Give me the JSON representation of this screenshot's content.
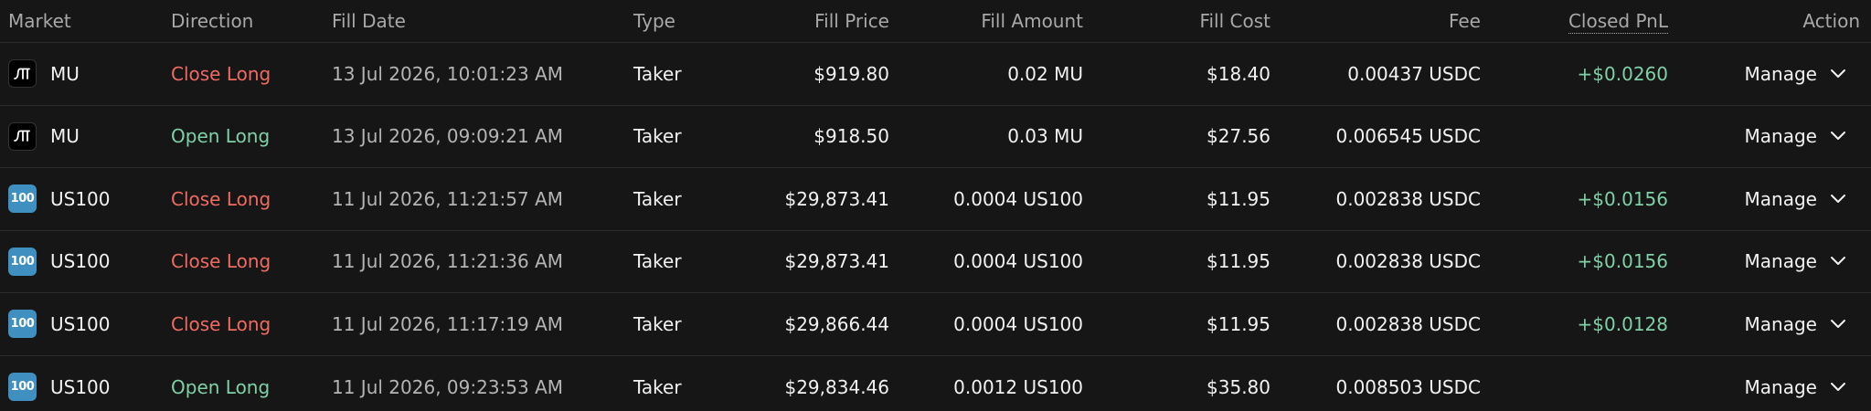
{
  "headers": {
    "market": "Market",
    "direction": "Direction",
    "fill_date": "Fill Date",
    "type": "Type",
    "fill_price": "Fill Price",
    "fill_amount": "Fill Amount",
    "fill_cost": "Fill Cost",
    "fee": "Fee",
    "closed_pnl": "Closed PnL",
    "action": "Action"
  },
  "colors": {
    "close": "#ef6b62",
    "open": "#7fd0a6",
    "us100_icon": "#3f8fc0"
  },
  "rows": [
    {
      "market": "MU",
      "icon": "mu-logo-icon",
      "icon_text": "",
      "direction": "Close Long",
      "direction_kind": "close",
      "fill_date": "13 Jul 2026, 10:01:23 AM",
      "type": "Taker",
      "fill_price": "$919.80",
      "fill_amount": "0.02 MU",
      "fill_cost": "$18.40",
      "fee": "0.00437 USDC",
      "closed_pnl": "+$0.0260",
      "action": "Manage"
    },
    {
      "market": "MU",
      "icon": "mu-logo-icon",
      "icon_text": "",
      "direction": "Open Long",
      "direction_kind": "open",
      "fill_date": "13 Jul 2026, 09:09:21 AM",
      "type": "Taker",
      "fill_price": "$918.50",
      "fill_amount": "0.03 MU",
      "fill_cost": "$27.56",
      "fee": "0.006545 USDC",
      "closed_pnl": "",
      "action": "Manage"
    },
    {
      "market": "US100",
      "icon": "us100-logo-icon",
      "icon_text": "100",
      "direction": "Close Long",
      "direction_kind": "close",
      "fill_date": "11 Jul 2026, 11:21:57 AM",
      "type": "Taker",
      "fill_price": "$29,873.41",
      "fill_amount": "0.0004 US100",
      "fill_cost": "$11.95",
      "fee": "0.002838 USDC",
      "closed_pnl": "+$0.0156",
      "action": "Manage"
    },
    {
      "market": "US100",
      "icon": "us100-logo-icon",
      "icon_text": "100",
      "direction": "Close Long",
      "direction_kind": "close",
      "fill_date": "11 Jul 2026, 11:21:36 AM",
      "type": "Taker",
      "fill_price": "$29,873.41",
      "fill_amount": "0.0004 US100",
      "fill_cost": "$11.95",
      "fee": "0.002838 USDC",
      "closed_pnl": "+$0.0156",
      "action": "Manage"
    },
    {
      "market": "US100",
      "icon": "us100-logo-icon",
      "icon_text": "100",
      "direction": "Close Long",
      "direction_kind": "close",
      "fill_date": "11 Jul 2026, 11:17:19 AM",
      "type": "Taker",
      "fill_price": "$29,866.44",
      "fill_amount": "0.0004 US100",
      "fill_cost": "$11.95",
      "fee": "0.002838 USDC",
      "closed_pnl": "+$0.0128",
      "action": "Manage"
    },
    {
      "market": "US100",
      "icon": "us100-logo-icon",
      "icon_text": "100",
      "direction": "Open Long",
      "direction_kind": "open",
      "fill_date": "11 Jul 2026, 09:23:53 AM",
      "type": "Taker",
      "fill_price": "$29,834.46",
      "fill_amount": "0.0012 US100",
      "fill_cost": "$35.80",
      "fee": "0.008503 USDC",
      "closed_pnl": "",
      "action": "Manage"
    }
  ]
}
